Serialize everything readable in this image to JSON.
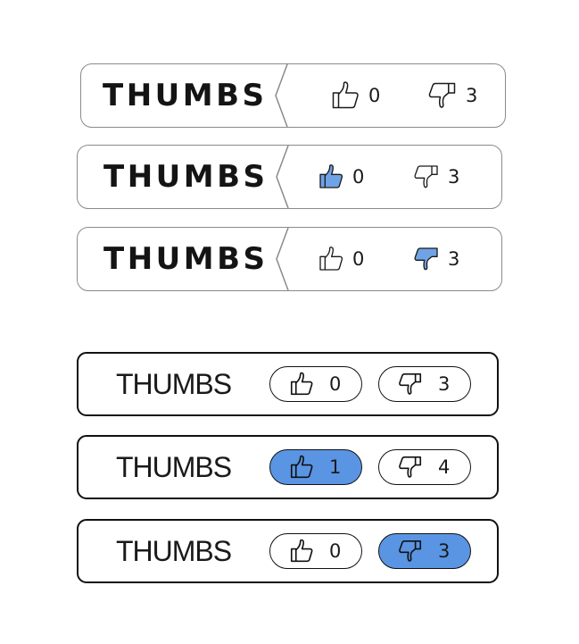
{
  "colors": {
    "accent": "#5a95e4",
    "border_a": "#8a8a8a",
    "border_b": "#111111"
  },
  "widgets": [
    {
      "style": "chevron",
      "title": "THUMBS",
      "up": {
        "count": "0",
        "active": false,
        "icon": "thumbs-up-icon"
      },
      "down": {
        "count": "3",
        "active": false,
        "icon": "thumbs-down-icon"
      }
    },
    {
      "style": "chevron",
      "title": "THUMBS",
      "up": {
        "count": "0",
        "active": true,
        "icon": "thumbs-up-icon"
      },
      "down": {
        "count": "3",
        "active": false,
        "icon": "thumbs-down-icon"
      }
    },
    {
      "style": "chevron",
      "title": "THUMBS",
      "up": {
        "count": "0",
        "active": false,
        "icon": "thumbs-up-icon"
      },
      "down": {
        "count": "3",
        "active": true,
        "icon": "thumbs-down-icon"
      }
    },
    {
      "style": "pill",
      "title": "THUMBS",
      "up": {
        "count": "0",
        "active": false,
        "icon": "thumbs-up-icon"
      },
      "down": {
        "count": "3",
        "active": false,
        "icon": "thumbs-down-icon"
      }
    },
    {
      "style": "pill",
      "title": "THUMBS",
      "up": {
        "count": "1",
        "active": true,
        "icon": "thumbs-up-icon"
      },
      "down": {
        "count": "4",
        "active": false,
        "icon": "thumbs-down-icon"
      }
    },
    {
      "style": "pill",
      "title": "THUMBS",
      "up": {
        "count": "0",
        "active": false,
        "icon": "thumbs-up-icon"
      },
      "down": {
        "count": "3",
        "active": true,
        "icon": "thumbs-down-icon"
      }
    }
  ]
}
